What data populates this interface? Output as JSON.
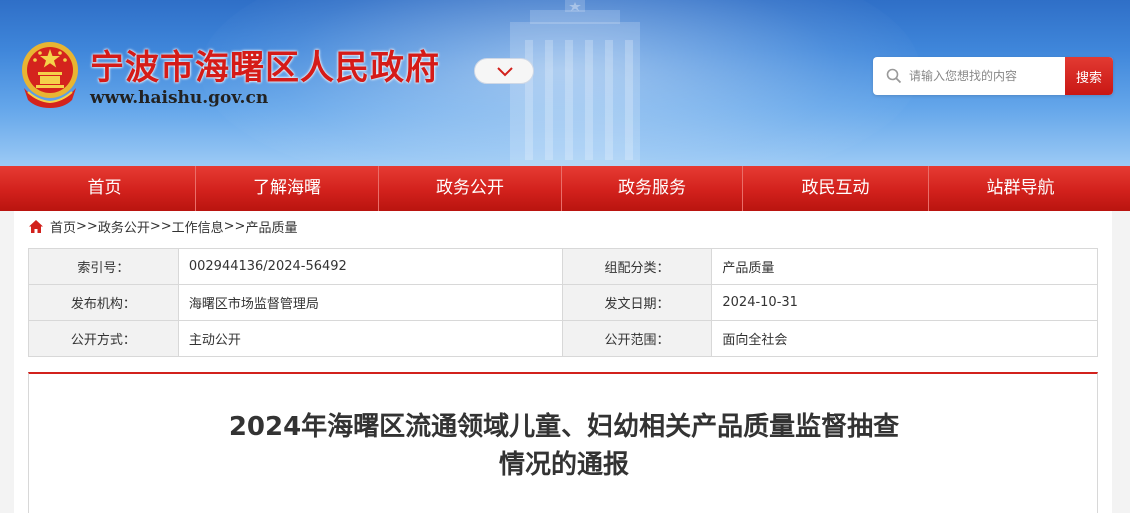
{
  "header": {
    "site_title": "宁波市海曙区人民政府",
    "site_url": "www.haishu.gov.cn",
    "search_placeholder": "请输入您想找的内容",
    "search_button": "搜索"
  },
  "nav": {
    "items": [
      "首页",
      "了解海曙",
      "政务公开",
      "政务服务",
      "政民互动",
      "站群导航"
    ]
  },
  "breadcrumb": {
    "items": [
      "首页",
      "政务公开",
      "工作信息",
      "产品质量"
    ],
    "separator": ">>"
  },
  "meta": {
    "rows": [
      {
        "k1": "索引号：",
        "v1": "002944136/2024-56492",
        "k2": "组配分类：",
        "v2": "产品质量"
      },
      {
        "k1": "发布机构：",
        "v1": "海曙区市场监督管理局",
        "k2": "发文日期：",
        "v2": "2024-10-31"
      },
      {
        "k1": "公开方式：",
        "v1": "主动公开",
        "k2": "公开范围：",
        "v2": "面向全社会"
      }
    ]
  },
  "article": {
    "title_line1": "2024年海曙区流通领域儿童、妇幼相关产品质量监督抽查",
    "title_line2": "情况的通报"
  },
  "colors": {
    "brand_red": "#d2211c",
    "header_blue": "#3f86da"
  }
}
